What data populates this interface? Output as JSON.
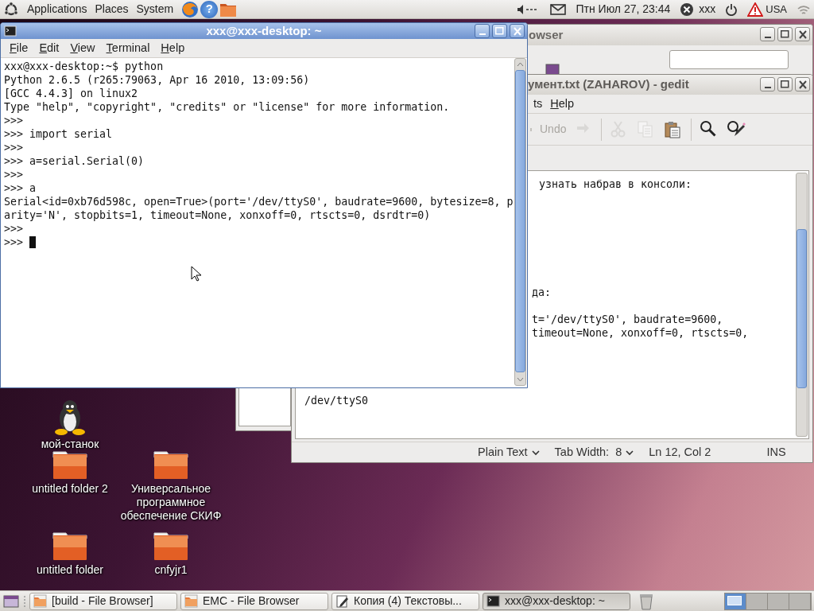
{
  "top_panel": {
    "menus": [
      "Applications",
      "Places",
      "System"
    ],
    "help_glyph": "?",
    "clock": "Птн Июл 27, 23:44",
    "user": "xxx",
    "keyboard_layout": "USA"
  },
  "file_browser": {
    "title": "owser"
  },
  "gedit": {
    "title": "умент.txt (ZAHAROV) - gedit",
    "menus": [
      {
        "label": "ts",
        "mnemonic": false
      },
      {
        "label": "Help",
        "mnemonic": true
      }
    ],
    "tools": [
      {
        "kind": "undo",
        "label": "Undo",
        "disabled": true
      },
      {
        "kind": "redo",
        "disabled": true
      },
      {
        "kind": "cut",
        "disabled": true
      },
      {
        "kind": "copy",
        "disabled": true
      },
      {
        "kind": "paste",
        "disabled": false
      },
      {
        "kind": "find",
        "disabled": false
      },
      {
        "kind": "replace",
        "disabled": false
      }
    ],
    "lines": [
      "узнать набрав в консоли:",
      "да:",
      "t='/dev/ttyS0', baudrate=9600,",
      "timeout=None, xonxoff=0, rtscts=0,",
      "/dev/ttyS0"
    ],
    "status": {
      "language": "Plain Text",
      "tab_width": "Tab Width:  8",
      "position": "Ln 12, Col 2",
      "mode": "INS"
    }
  },
  "terminal": {
    "title": "xxx@xxx-desktop: ~",
    "menus": [
      {
        "label": "File",
        "mnemonic": true
      },
      {
        "label": "Edit",
        "mnemonic": true
      },
      {
        "label": "View",
        "mnemonic": true
      },
      {
        "label": "Terminal",
        "mnemonic": true
      },
      {
        "label": "Help",
        "mnemonic": true
      }
    ],
    "lines": [
      "xxx@xxx-desktop:~$ python",
      "Python 2.6.5 (r265:79063, Apr 16 2010, 13:09:56)",
      "[GCC 4.4.3] on linux2",
      "Type \"help\", \"copyright\", \"credits\" or \"license\" for more information.",
      ">>> ",
      ">>> import serial",
      ">>> ",
      ">>> a=serial.Serial(0)",
      ">>> ",
      ">>> a",
      "Serial<id=0xb76d598c, open=True>(port='/dev/ttyS0', baudrate=9600, bytesize=8, p",
      "arity='N', stopbits=1, timeout=None, xonxoff=0, rtscts=0, dsrdtr=0)",
      ">>> ",
      ">>> "
    ],
    "cursor": true
  },
  "desktop_icons": [
    {
      "label": "мой-станок",
      "kind": "penguin"
    },
    {
      "label": "untitled folder 2",
      "kind": "folder"
    },
    {
      "label": "Универсальное программное обеспечение СКИФ",
      "kind": "folder"
    },
    {
      "label": "untitled folder",
      "kind": "folder"
    },
    {
      "label": "cnfyjr1",
      "kind": "folder"
    }
  ],
  "taskbar": {
    "tasks": [
      {
        "label": "[build - File Browser]",
        "kind": "folder",
        "selected": false
      },
      {
        "label": "EMC - File Browser",
        "kind": "folder",
        "selected": false
      },
      {
        "label": "Копия (4) Текстовы...",
        "kind": "editor",
        "selected": false
      },
      {
        "label": "xxx@xxx-desktop: ~",
        "kind": "terminal",
        "selected": true
      }
    ],
    "workspaces": [
      {
        "selected": true
      },
      {
        "selected": false
      },
      {
        "selected": false
      },
      {
        "selected": false
      }
    ]
  }
}
